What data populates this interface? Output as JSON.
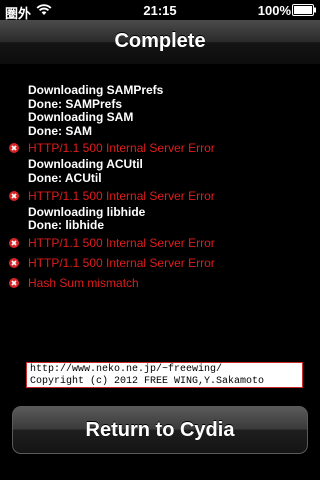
{
  "status_bar": {
    "carrier": "圏外",
    "time": "21:15",
    "battery_percent": "100%"
  },
  "nav": {
    "title": "Complete"
  },
  "log": [
    {
      "type": "status",
      "text": "Downloading SAMPrefs"
    },
    {
      "type": "status",
      "text": "Done: SAMPrefs"
    },
    {
      "type": "status",
      "text": "Downloading SAM"
    },
    {
      "type": "status",
      "text": "Done: SAM"
    },
    {
      "type": "error",
      "text": "HTTP/1.1 500 Internal Server Error"
    },
    {
      "type": "status",
      "text": "Downloading ACUtil"
    },
    {
      "type": "status",
      "text": "Done: ACUtil"
    },
    {
      "type": "error",
      "text": "HTTP/1.1 500 Internal Server Error"
    },
    {
      "type": "status",
      "text": "Downloading libhide"
    },
    {
      "type": "status",
      "text": "Done: libhide"
    },
    {
      "type": "error",
      "text": "HTTP/1.1 500 Internal Server Error"
    },
    {
      "type": "error",
      "text": "HTTP/1.1 500 Internal Server Error"
    },
    {
      "type": "error",
      "text": "Hash Sum mismatch"
    }
  ],
  "credits": {
    "url": "http://www.neko.ne.jp/~freewing/",
    "copyright": "Copyright (c) 2012 FREE WING,Y.Sakamoto"
  },
  "return_button": {
    "label": "Return to Cydia"
  },
  "colors": {
    "error_text": "#e01d1d",
    "error_icon": "#d6262a"
  },
  "icons": {
    "wifi": "wifi-icon",
    "battery": "battery-icon",
    "error": "error-x-icon"
  }
}
